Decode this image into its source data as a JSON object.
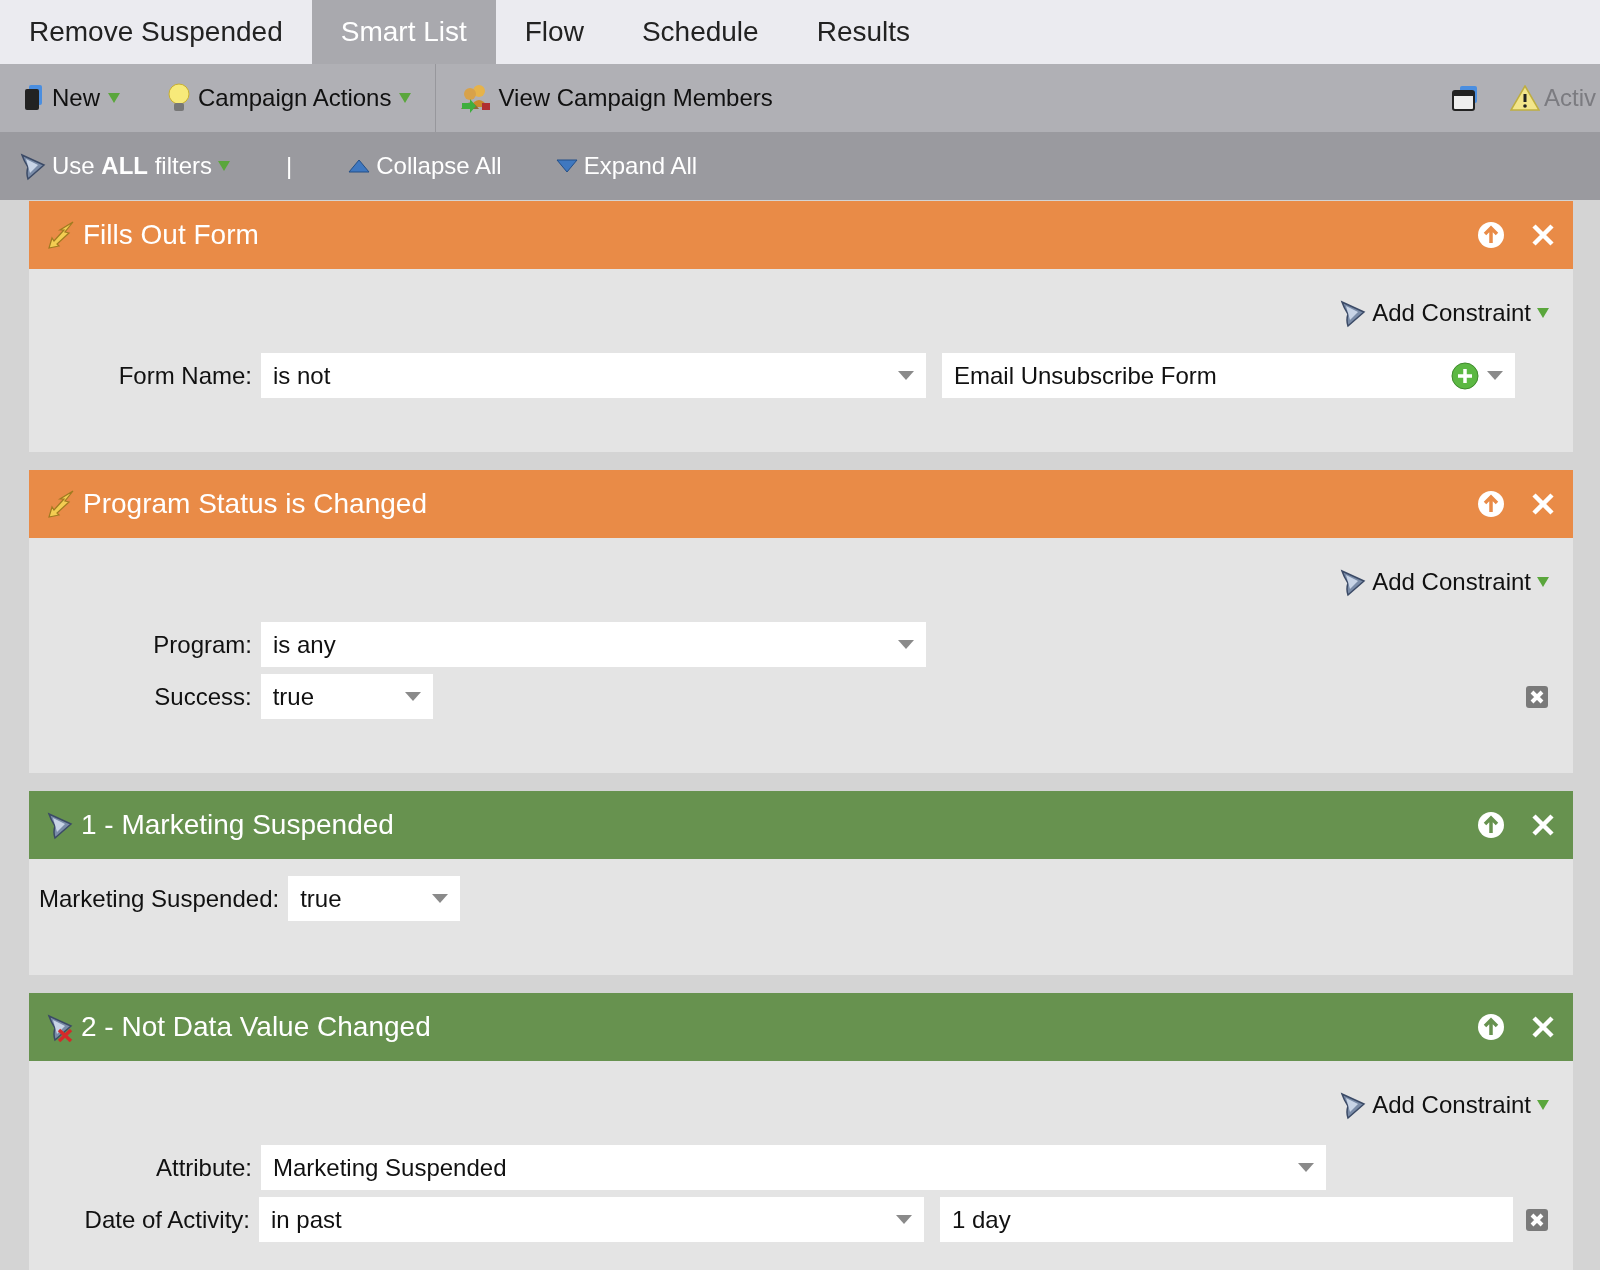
{
  "tabs": [
    {
      "label": "Remove Suspended",
      "selected": false
    },
    {
      "label": "Smart List",
      "selected": true
    },
    {
      "label": "Flow",
      "selected": false
    },
    {
      "label": "Schedule",
      "selected": false
    },
    {
      "label": "Results",
      "selected": false
    }
  ],
  "toolbar": {
    "items": [
      {
        "label": "New",
        "kind": "menu"
      },
      {
        "label": "Campaign Actions",
        "kind": "menu"
      },
      {
        "label": "View Campaign Members",
        "kind": "button"
      }
    ],
    "status": "Activ"
  },
  "filter_bar": {
    "logic": "Use **ALL** filters",
    "separator": "|",
    "collapse": "Collapse All",
    "expand": "Expand All"
  },
  "filters": [
    {
      "title": "Fills Out Form",
      "kind": "trigger",
      "color": "#e98b47",
      "add_constraint": "Add Constraint",
      "rows": [
        {
          "label": "Form Name:",
          "removable": false,
          "fields": [
            {
              "kind": "select",
              "value": "is not"
            },
            {
              "kind": "picker",
              "value": "Email Unsubscribe Form"
            }
          ]
        }
      ]
    },
    {
      "title": "Program Status is Changed",
      "kind": "trigger",
      "color": "#e98b47",
      "add_constraint": "Add Constraint",
      "rows": [
        {
          "label": "Program:",
          "removable": false,
          "fields": [
            {
              "kind": "select",
              "value": "is any"
            }
          ]
        },
        {
          "label": "Success:",
          "removable": true,
          "fields": [
            {
              "kind": "short_select",
              "value": "true"
            }
          ]
        }
      ]
    },
    {
      "title": "1 - Marketing Suspended",
      "kind": "filter",
      "color": "#67924f",
      "rows": [
        {
          "label": "Marketing Suspended:",
          "removable": false,
          "fields": [
            {
              "kind": "short_select",
              "value": "true"
            }
          ]
        }
      ]
    },
    {
      "title": "2 - Not Data Value Changed",
      "kind": "negated_filter",
      "color": "#67924f",
      "add_constraint": "Add Constraint",
      "rows": [
        {
          "label": "Attribute:",
          "removable": false,
          "fields": [
            {
              "kind": "long_select",
              "value": "Marketing Suspended"
            }
          ]
        },
        {
          "label": "Date of Activity:",
          "removable": true,
          "fields": [
            {
              "kind": "select",
              "value": "in past"
            },
            {
              "kind": "text",
              "value": "1 day"
            }
          ]
        }
      ]
    }
  ]
}
